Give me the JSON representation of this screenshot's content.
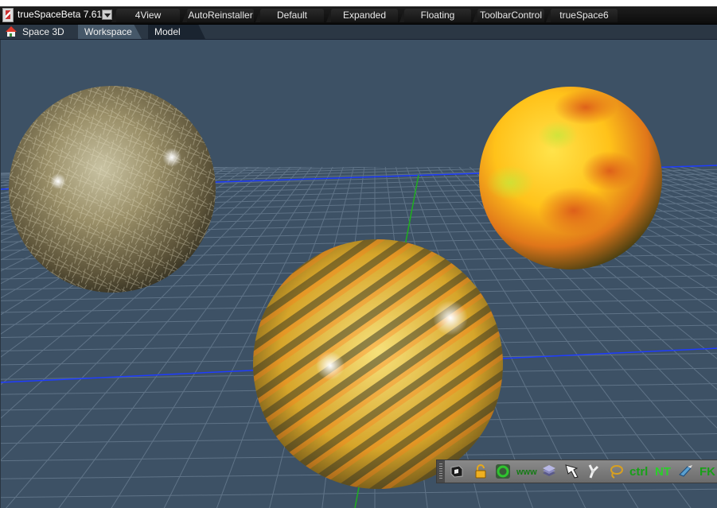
{
  "app": {
    "title": "trueSpaceBeta 7.61"
  },
  "layout_tabs": [
    "4View",
    "AutoReinstaller",
    "Default",
    "Expanded",
    "Floating",
    "ToolbarControl",
    "trueSpace6"
  ],
  "view_bar": {
    "space_label": "Space 3D",
    "tabs": [
      "Workspace",
      "Model"
    ],
    "active_tab": "Workspace"
  },
  "toolbar": {
    "www_label": "www",
    "ctrl_label": "ctrl",
    "nt_label": "NT",
    "fk_label": "FK",
    "icons": [
      "dark-cube-icon",
      "padlock-icon",
      "green-circle-icon",
      "www-icon",
      "layers-icon",
      "cursor-icon",
      "bone-icon",
      "lasso-icon",
      "ctrl-icon",
      "nt-icon",
      "paint-tool-icon",
      "fk-icon"
    ]
  },
  "colors": {
    "viewport_bg": "#3d5165",
    "grid": "#6b7f93",
    "x_axis": "#1e3cff",
    "y_axis": "#1fae1f",
    "toolbar_bg": "#7a7a7a"
  }
}
